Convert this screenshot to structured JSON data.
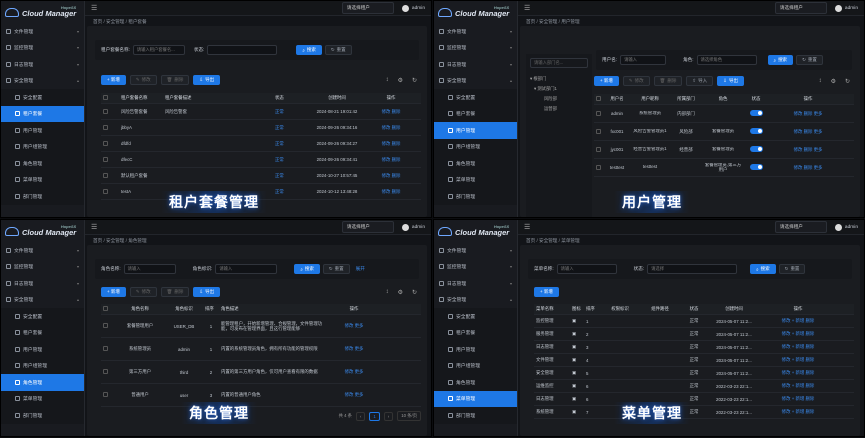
{
  "app": {
    "name": "Cloud Manager",
    "sup": "HopeSS",
    "tenant_placeholder": "请选择租户",
    "user": "admin"
  },
  "menu": {
    "top": [
      "文件管理",
      "监控管理",
      "日志管理",
      "安全管理"
    ],
    "sub": [
      "安全配置",
      "租户套餐",
      "用户管理",
      "用户组管理",
      "角色管理",
      "菜单管理",
      "部门管理"
    ]
  },
  "common": {
    "add": "+ 新增",
    "edit": "修改",
    "delete": "删除",
    "export": "导出",
    "import": "导入",
    "search": "搜索",
    "reset": "重置",
    "expand": "展开",
    "ops_edit": "修改",
    "ops_del": "删除",
    "ops_more": "更多",
    "input_ph": "请输入",
    "select_ph": "请选择"
  },
  "q1": {
    "breadcrumb": "首页  /  安全管理  /  租户套餐",
    "search_label1": "租户套餐名称:",
    "search_ph1": "请输入租户套餐名...",
    "search_label2": "状态:",
    "headers": [
      "租户套餐名称",
      "租户套餐描述",
      "状态",
      "创建时间",
      "操作"
    ],
    "rows": [
      {
        "name": "风险告警套餐",
        "desc": "风险告警套",
        "time": "2024-08-21 19:01:42"
      },
      {
        "name": "jbbyA",
        "desc": "",
        "time": "2024-09-26 09:34:16"
      },
      {
        "name": "dfdfd",
        "desc": "",
        "time": "2024-09-26 09:34:27"
      },
      {
        "name": "dfecC",
        "desc": "",
        "time": "2024-09-26 09:34:41"
      },
      {
        "name": "默认租户套餐",
        "desc": "",
        "time": "2024-10-27 10:57:45"
      },
      {
        "name": "testA",
        "desc": "",
        "time": "2024-10-12 13:48:28"
      }
    ],
    "status_tag": "正常",
    "caption": "租户套餐管理"
  },
  "q2": {
    "breadcrumb": "首页  /  安全管理  /  用户管理",
    "tree_ph": "请输入部门名...",
    "tree": [
      "▾ 根部门",
      "  ▾ 测试部门1",
      "风险部",
      "运营部"
    ],
    "search_label1": "用户名:",
    "search_label2": "角色:",
    "role_ph": "请选择角色",
    "headers": [
      "用户名",
      "用户昵称",
      "所属部门",
      "角色",
      "状态",
      "操作"
    ],
    "rows": [
      {
        "u": "admin",
        "n": "系统管理员",
        "d": "内部部门",
        "r": ""
      },
      {
        "u": "fxc001",
        "n": "风险告警管理员1",
        "d": "风险部",
        "r": "套餐管理员"
      },
      {
        "u": "jyc001",
        "n": "经营告警管理员1",
        "d": "经营部",
        "r": "套餐管理员"
      },
      {
        "u": "testtest",
        "n": "testtest",
        "d": "",
        "r": "套餐管理员,第三方用户"
      }
    ],
    "caption": "用户管理"
  },
  "q3": {
    "breadcrumb": "首页  /  安全管理  /  角色管理",
    "search_label1": "角色名称:",
    "search_label2": "角色标识:",
    "headers": [
      "角色名称",
      "角色标识",
      "排序",
      "角色描述",
      "操作"
    ],
    "rows": [
      {
        "n": "套餐管理用户",
        "k": "USER_DB",
        "s": "1",
        "d": "能管理租户，开始新增管理、合规管理，文件管理功能，可发布在管理界面，且这行管理能够"
      },
      {
        "n": "系统管理员",
        "k": "admin",
        "s": "1",
        "d": "内置的系统管理员角色，拥有所有功能的管理权限"
      },
      {
        "n": "第三方用户",
        "k": "third",
        "s": "2",
        "d": "内置的第三方用户角色，仅可用户查看有限的数据"
      },
      {
        "n": "普通用户",
        "k": "user",
        "s": "3",
        "d": "内置的普通用户角色"
      }
    ],
    "pager_total": "共 4 条",
    "pager_page": "1",
    "pager_size": "10 条/页",
    "caption": "角色管理"
  },
  "q4": {
    "breadcrumb": "首页  /  安全管理  /  菜单管理",
    "search_label1": "菜单名称:",
    "search_label2": "状态:",
    "headers": [
      "菜单名称",
      "图标",
      "排序",
      "权限标识",
      "组件路径",
      "状态",
      "创建时间",
      "操作"
    ],
    "rows": [
      {
        "n": "监控管理",
        "s": "1",
        "t": "2024-05-07 11:2..."
      },
      {
        "n": "服务管理",
        "s": "2",
        "t": "2024-05-07 11:2..."
      },
      {
        "n": "日志管理",
        "s": "3",
        "t": "2024-05-07 11:2..."
      },
      {
        "n": "文件管理",
        "s": "4",
        "t": "2024-05-07 11:2..."
      },
      {
        "n": "安全管理",
        "s": "5",
        "t": "2024-05-07 11:2..."
      },
      {
        "n": "运维监控",
        "s": "6",
        "t": "2022-03-23 22:1..."
      },
      {
        "n": "日志管理",
        "s": "6",
        "t": "2022-03-23 22:1..."
      },
      {
        "n": "系统管理",
        "s": "7",
        "t": "2022-03-23 22:1..."
      }
    ],
    "status_tag": "正常",
    "caption": "菜单管理"
  }
}
